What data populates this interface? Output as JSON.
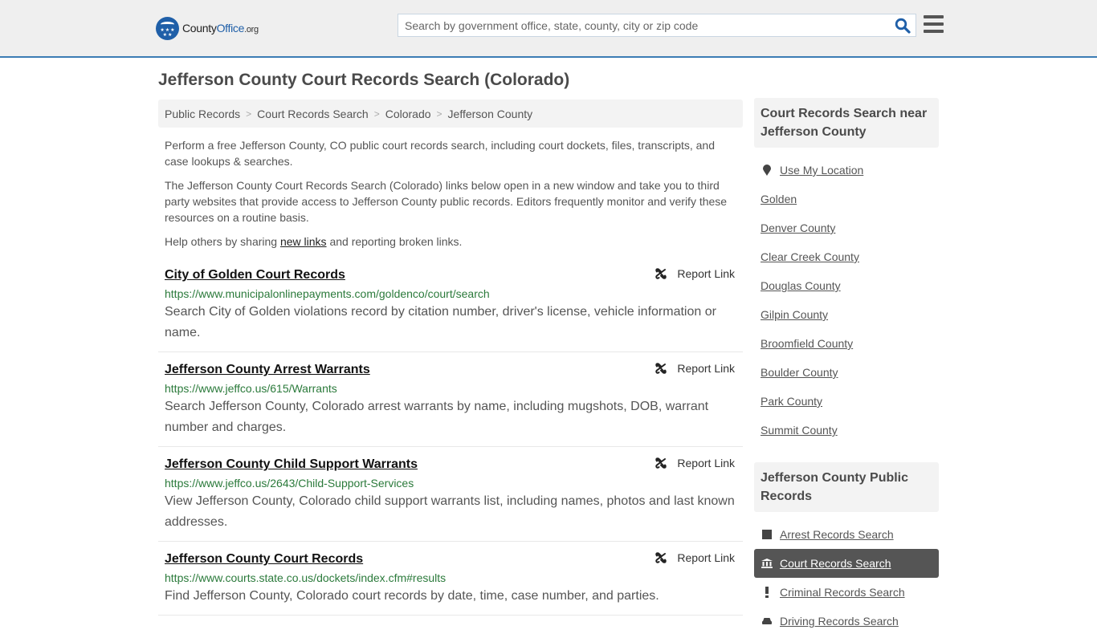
{
  "header": {
    "logo": {
      "part1": "County",
      "part2": "Office",
      "part3": ".org"
    },
    "search": {
      "placeholder": "Search by government office, state, county, city or zip code",
      "value": ""
    },
    "search_icon": "search-icon",
    "menu_icon": "hamburger-menu-icon"
  },
  "page": {
    "title": "Jefferson County Court Records Search (Colorado)"
  },
  "breadcrumb": [
    {
      "label": "Public Records"
    },
    {
      "label": "Court Records Search"
    },
    {
      "label": "Colorado"
    },
    {
      "label": "Jefferson County"
    }
  ],
  "intro": {
    "p1": "Perform a free Jefferson County, CO public court records search, including court dockets, files, transcripts, and case lookups & searches.",
    "p2": "The Jefferson County Court Records Search (Colorado) links below open in a new window and take you to third party websites that provide access to Jefferson County public records. Editors frequently monitor and verify these resources on a routine basis.",
    "p3_before": "Help others by sharing ",
    "p3_link": "new links",
    "p3_after": " and reporting broken links."
  },
  "report_label": "Report Link",
  "listings": [
    {
      "title": "City of Golden Court Records",
      "url": "https://www.municipalonlinepayments.com/goldenco/court/search",
      "description": "Search City of Golden violations record by citation number, driver's license, vehicle information or name."
    },
    {
      "title": "Jefferson County Arrest Warrants",
      "url": "https://www.jeffco.us/615/Warrants",
      "description": "Search Jefferson County, Colorado arrest warrants by name, including mugshots, DOB, warrant number and charges."
    },
    {
      "title": "Jefferson County Child Support Warrants",
      "url": "https://www.jeffco.us/2643/Child-Support-Services",
      "description": "View Jefferson County, Colorado child support warrants list, including names, photos and last known addresses."
    },
    {
      "title": "Jefferson County Court Records",
      "url": "https://www.courts.state.co.us/dockets/index.cfm#results",
      "description": "Find Jefferson County, Colorado court records by date, time, case number, and parties."
    }
  ],
  "sidebar": {
    "nearby": {
      "heading": "Court Records Search near Jefferson County",
      "use_location": "Use My Location",
      "items": [
        "Golden",
        "Denver County",
        "Clear Creek County",
        "Douglas County",
        "Gilpin County",
        "Broomfield County",
        "Boulder County",
        "Park County",
        "Summit County"
      ]
    },
    "public_records": {
      "heading": "Jefferson County Public Records",
      "items": [
        {
          "label": "Arrest Records Search",
          "icon": "square-icon",
          "active": false
        },
        {
          "label": "Court Records Search",
          "icon": "courthouse-icon",
          "active": true
        },
        {
          "label": "Criminal Records Search",
          "icon": "exclamation-icon",
          "active": false
        },
        {
          "label": "Driving Records Search",
          "icon": "car-icon",
          "active": false
        }
      ]
    }
  },
  "colors": {
    "accent": "#3c7cb4",
    "brand_blue": "#1f5fa8",
    "url_green": "#2b7a3b",
    "active_bg": "#555555"
  }
}
